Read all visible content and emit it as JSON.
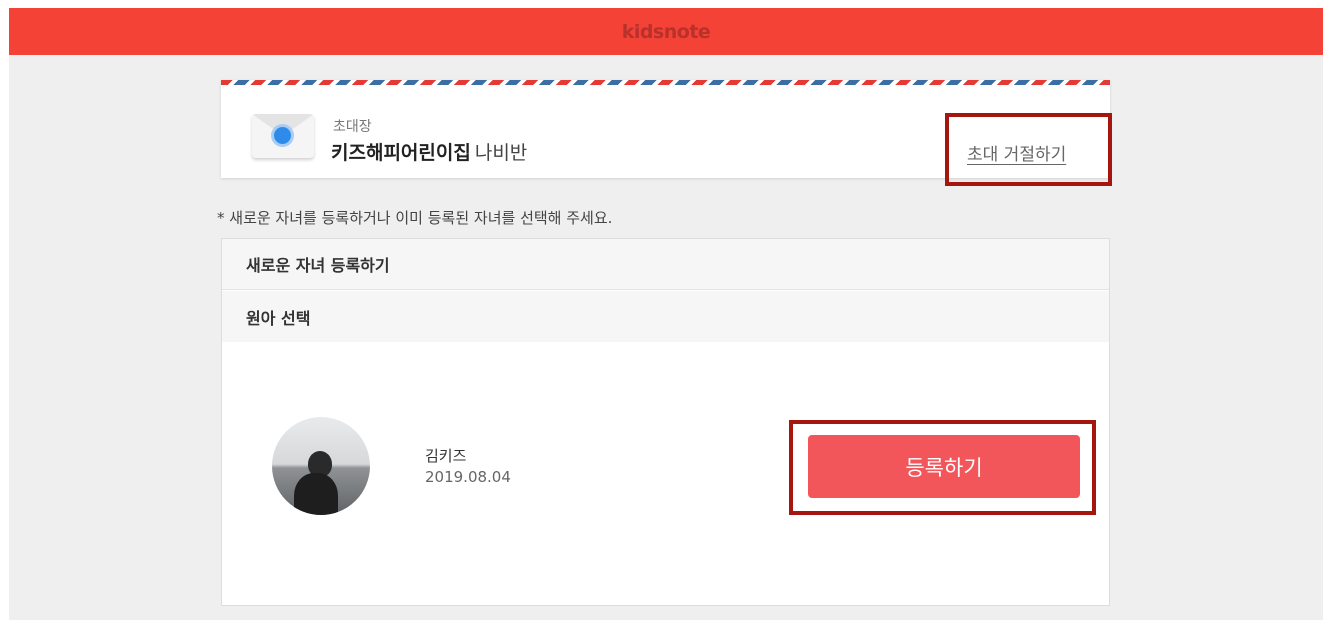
{
  "header": {
    "logo_text": "kidsnote"
  },
  "invite": {
    "label": "초대장",
    "school_name": "키즈해피어린이집",
    "class_name": "나비반",
    "reject_label": "초대 거절하기"
  },
  "instruction": "* 새로운 자녀를 등록하거나 이미 등록된 자녀를 선택해 주세요.",
  "panel": {
    "new_child_label": "새로운 자녀 등록하기",
    "select_child_label": "원아 선택",
    "children": [
      {
        "name": "김키즈",
        "birthdate": "2019.08.04",
        "register_label": "등록하기"
      }
    ]
  },
  "colors": {
    "brand": "#f44336",
    "button": "#f2565a",
    "highlight": "#a5160f"
  }
}
